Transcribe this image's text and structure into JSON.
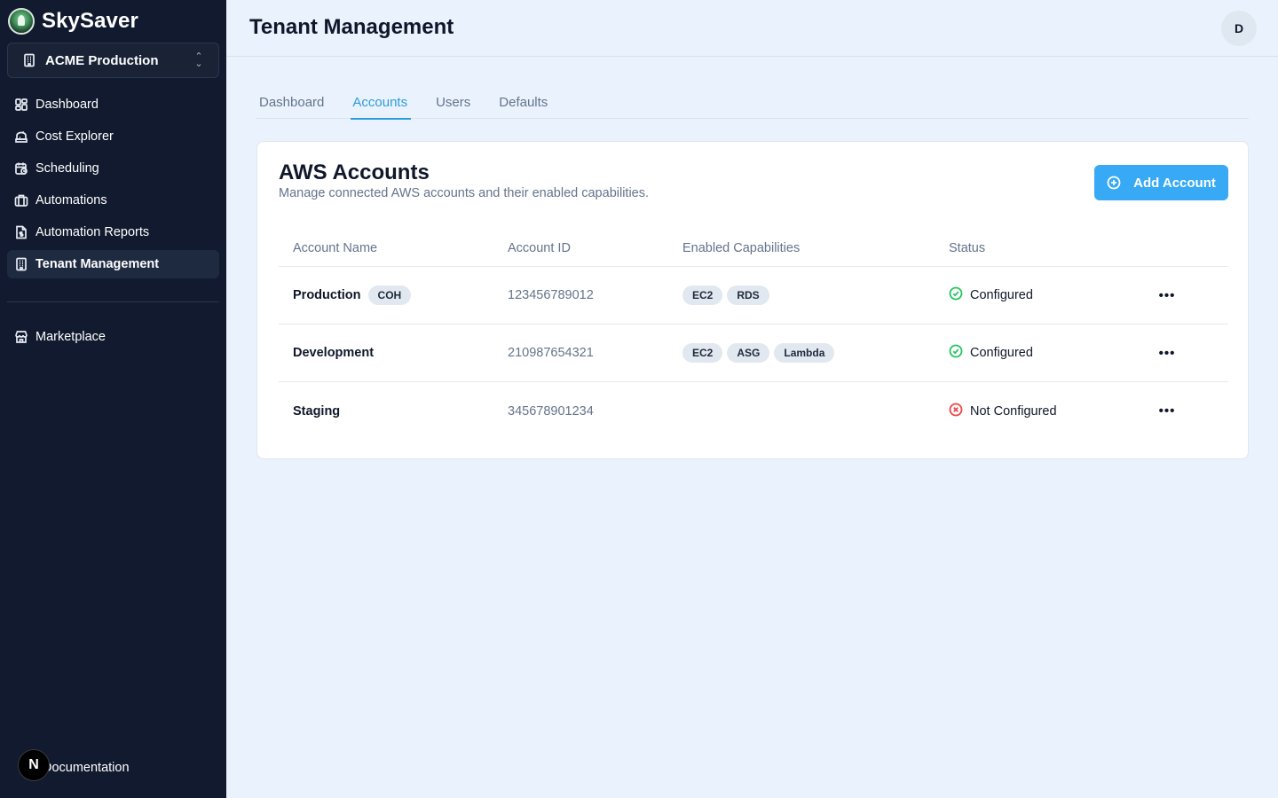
{
  "app": {
    "brand_name": "SkySaver",
    "tenant_selector": "ACME Production"
  },
  "sidebar": {
    "items": [
      {
        "label": "Dashboard",
        "icon": "dashboard-icon"
      },
      {
        "label": "Cost Explorer",
        "icon": "piggy-bank-icon"
      },
      {
        "label": "Scheduling",
        "icon": "calendar-clock-icon"
      },
      {
        "label": "Automations",
        "icon": "briefcase-icon"
      },
      {
        "label": "Automation Reports",
        "icon": "file-dollar-icon"
      },
      {
        "label": "Tenant Management",
        "icon": "building-icon",
        "active": true
      }
    ],
    "secondary_items": [
      {
        "label": "Marketplace",
        "icon": "store-icon"
      }
    ],
    "footer": {
      "documentation": "Documentation",
      "badge": "N"
    }
  },
  "header": {
    "title": "Tenant Management",
    "avatar_initial": "D"
  },
  "tabs": [
    {
      "label": "Dashboard"
    },
    {
      "label": "Accounts",
      "active": true
    },
    {
      "label": "Users"
    },
    {
      "label": "Defaults"
    }
  ],
  "card": {
    "title": "AWS Accounts",
    "subtitle": "Manage connected AWS accounts and their enabled capabilities.",
    "add_button": "Add Account",
    "columns": [
      "Account Name",
      "Account ID",
      "Enabled Capabilities",
      "Status"
    ],
    "rows": [
      {
        "name": "Production",
        "tag": "COH",
        "id": "123456789012",
        "capabilities": [
          "EC2",
          "RDS"
        ],
        "status": "Configured",
        "configured": true
      },
      {
        "name": "Development",
        "tag": "",
        "id": "210987654321",
        "capabilities": [
          "EC2",
          "ASG",
          "Lambda"
        ],
        "status": "Configured",
        "configured": true
      },
      {
        "name": "Staging",
        "tag": "",
        "id": "345678901234",
        "capabilities": [],
        "status": "Not Configured",
        "configured": false
      }
    ]
  },
  "colors": {
    "sidebar_bg": "#111a2e",
    "accent": "#2d9cdb",
    "button": "#38a9f4",
    "success": "#22c55e",
    "danger": "#ef4444"
  }
}
